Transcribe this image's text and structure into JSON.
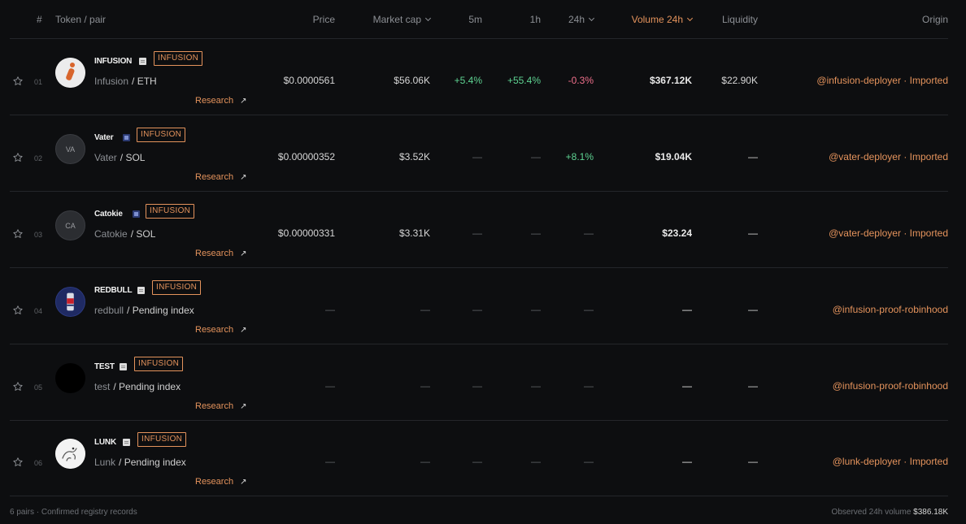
{
  "header": {
    "num": "#",
    "token": "Token / pair",
    "price": "Price",
    "mcap": "Market cap",
    "m5": "5m",
    "h1": "1h",
    "h24": "24h",
    "vol": "Volume 24h",
    "liq": "Liquidity",
    "origin": "Origin"
  },
  "colors": {
    "accent": "#e4935c",
    "positive": "#5ed392",
    "negative": "#f0708c"
  },
  "rows": [
    {
      "num": "01",
      "symbol": "INFUSION",
      "badge": "INFUSION",
      "base": "Infusion",
      "quote": "/ ETH",
      "research": "Research",
      "arrow": "↗",
      "price": "$0.0000561",
      "mcap": "$56.06K",
      "m5": "+5.4%",
      "h1": "+55.4%",
      "h24": "-0.3%",
      "vol": "$367.12K",
      "liq": "$22.90K",
      "origin": "@infusion-deployer · Imported"
    },
    {
      "num": "02",
      "symbol": "Vater",
      "badge": "INFUSION",
      "avatar": "VA",
      "base": "Vater",
      "quote": "/ SOL",
      "research": "Research",
      "arrow": "↗",
      "price": "$0.00000352",
      "mcap": "$3.52K",
      "m5": "—",
      "h1": "—",
      "h24": "+8.1%",
      "vol": "$19.04K",
      "liq": "—",
      "origin": "@vater-deployer · Imported"
    },
    {
      "num": "03",
      "symbol": "Catokie",
      "badge": "INFUSION",
      "avatar": "CA",
      "base": "Catokie",
      "quote": "/ SOL",
      "research": "Research",
      "arrow": "↗",
      "price": "$0.00000331",
      "mcap": "$3.31K",
      "m5": "—",
      "h1": "—",
      "h24": "—",
      "vol": "$23.24",
      "liq": "—",
      "origin": "@vater-deployer · Imported"
    },
    {
      "num": "04",
      "symbol": "REDBULL",
      "badge": "INFUSION",
      "base": "redbull",
      "quote": "/ Pending index",
      "research": "Research",
      "arrow": "↗",
      "price": "—",
      "mcap": "—",
      "m5": "—",
      "h1": "—",
      "h24": "—",
      "vol": "—",
      "liq": "—",
      "origin": "@infusion-proof-robinhood"
    },
    {
      "num": "05",
      "symbol": "TEST",
      "badge": "INFUSION",
      "base": "test",
      "quote": "/ Pending index",
      "research": "Research",
      "arrow": "↗",
      "price": "—",
      "mcap": "—",
      "m5": "—",
      "h1": "—",
      "h24": "—",
      "vol": "—",
      "liq": "—",
      "origin": "@infusion-proof-robinhood"
    },
    {
      "num": "06",
      "symbol": "LUNK",
      "badge": "INFUSION",
      "base": "Lunk",
      "quote": "/ Pending index",
      "research": "Research",
      "arrow": "↗",
      "price": "—",
      "mcap": "—",
      "m5": "—",
      "h1": "—",
      "h24": "—",
      "vol": "—",
      "liq": "—",
      "origin": "@lunk-deployer · Imported"
    }
  ],
  "footer": {
    "summary": "6 pairs · Confirmed registry records",
    "volume_label": "Observed 24h volume",
    "volume_value": "$386.18K"
  }
}
